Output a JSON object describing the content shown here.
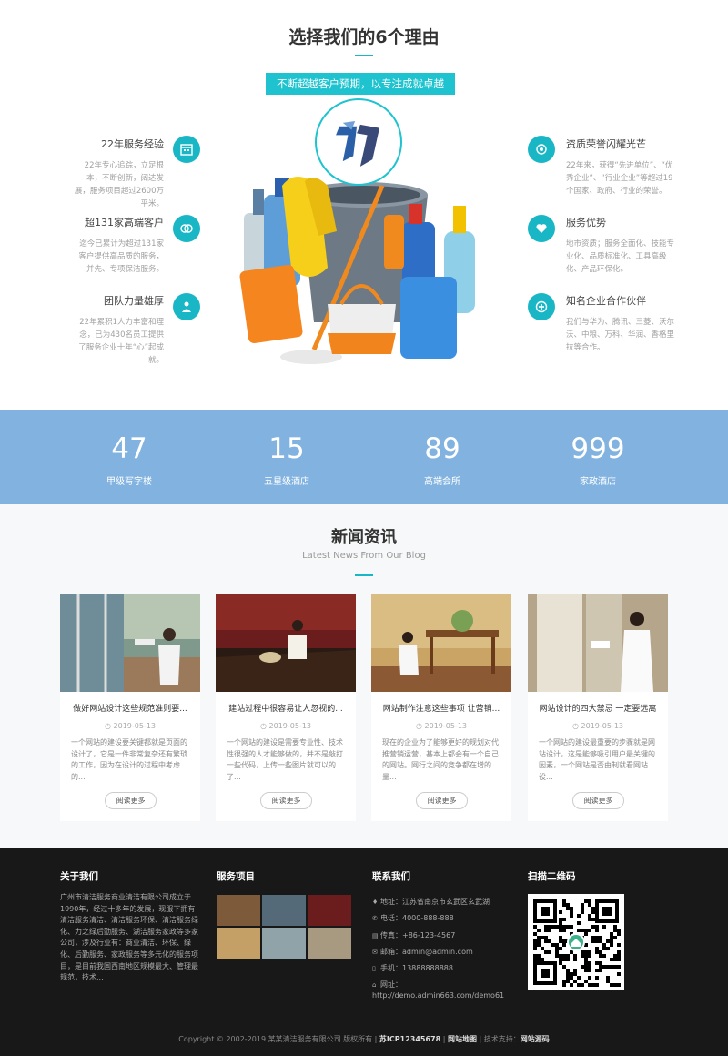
{
  "reasons": {
    "title": "选择我们的6个理由",
    "banner": "不断超越客户预期，以专注成就卓越",
    "left": [
      {
        "title": "22年服务经验",
        "desc": "22年专心追踪，立足根本，不断创新，阔达发展，服务项目超过2600万平米。",
        "icon": "calendar-icon"
      },
      {
        "title": "超131家高端客户",
        "desc": "迄今已累计为超过131家客户提供高品质的服务，并先、专项保洁服务。",
        "icon": "handshake-icon"
      },
      {
        "title": "团队力量雄厚",
        "desc": "22年累积1人力丰富和理念，已为430名员工提供了服务企业十年“心”起成就。",
        "icon": "team-icon"
      }
    ],
    "right": [
      {
        "title": "资质荣誉闪耀光芒",
        "desc": "22年来，获得“先进单位”、“优秀企业”、“行业企业”等超过19个国家、政府、行业的荣誉。",
        "icon": "award-icon"
      },
      {
        "title": "服务优势",
        "desc": "地市资质；服务全面化、技能专业化、品质标准化、工具高级化、产品环保化。",
        "icon": "heart-icon"
      },
      {
        "title": "知名企业合作伙伴",
        "desc": "我们与华为、腾讯、三菱、沃尔沃、中粮、万科、华润、香格里拉等合作。",
        "icon": "plus-icon"
      }
    ]
  },
  "stats": [
    {
      "num": "47",
      "label": "甲级写字楼"
    },
    {
      "num": "15",
      "label": "五星级酒店"
    },
    {
      "num": "89",
      "label": "高端会所"
    },
    {
      "num": "999",
      "label": "家政酒店"
    }
  ],
  "news": {
    "title": "新闻资讯",
    "subtitle": "Latest News From Our Blog",
    "more_label": "阅读更多",
    "items": [
      {
        "title": "做好网站设计这些规范准则要...",
        "date": "2019-05-13",
        "excerpt": "一个网站的建设要关键都就是页面的设计了，它是一件非常复杂还有繁琐的工作，因为在设计的过程中考虑的..."
      },
      {
        "title": "建站过程中很容易让人忽视的...",
        "date": "2019-05-13",
        "excerpt": "一个网站的建设是需要专业性、技术性很强的人才能够做的，并不是敲打一些代码，上传一些图片就可以的了..."
      },
      {
        "title": "网站制作注意这些事项 让营销...",
        "date": "2019-05-13",
        "excerpt": "现在的企业为了能够更好的规划对代推营销运营，基本上都会有一个自己的网站。网行之间的竞争都在增的量..."
      },
      {
        "title": "网站设计的四大禁忌 一定要远离",
        "date": "2019-05-13",
        "excerpt": "一个网站的建设最重要的步骤就是网站设计，这是能够吸引用户最关键的因素，一个网站是否由制就看网站设..."
      }
    ]
  },
  "footer": {
    "about_title": "关于我们",
    "about_text": "广州市清洁服务商业清洁有限公司成立于1990年，经过十多年的发展，现服下拥有清洁服务清洁、清洁服务环保、清洁服务绿化、力之绿后勤服务、湖洁服务家政等多家公司，涉及行业有：商业清洁、环保、绿化、后勤服务、家政服务等多元化的服务项目，是目前我国西南地区规模最大、管理最规范，技术...",
    "services_title": "服务项目",
    "contact_title": "联系我们",
    "contact": [
      {
        "icon": "location-icon",
        "glyph": "♦",
        "text": "地址：江苏省南京市玄武区玄武湖"
      },
      {
        "icon": "phone-icon",
        "glyph": "✆",
        "text": "电话：4000-888-888"
      },
      {
        "icon": "fax-icon",
        "glyph": "▤",
        "text": "传真：+86-123-4567"
      },
      {
        "icon": "mail-icon",
        "glyph": "✉",
        "text": "邮箱：admin@admin.com"
      },
      {
        "icon": "mobile-icon",
        "glyph": "▯",
        "text": "手机：13888888888"
      },
      {
        "icon": "home-icon",
        "glyph": "⌂",
        "text": "网址："
      }
    ],
    "website": "http://demo.admin663.com/demo61",
    "qr_title": "扫描二维码",
    "copyright_prefix": "Copyright © 2002-2019 某某清洁服务有限公司 版权所有 |",
    "icp": "苏ICP12345678",
    "sitemap": "网站地图",
    "tech_label": "技术支持：",
    "tech": "网站源码"
  }
}
